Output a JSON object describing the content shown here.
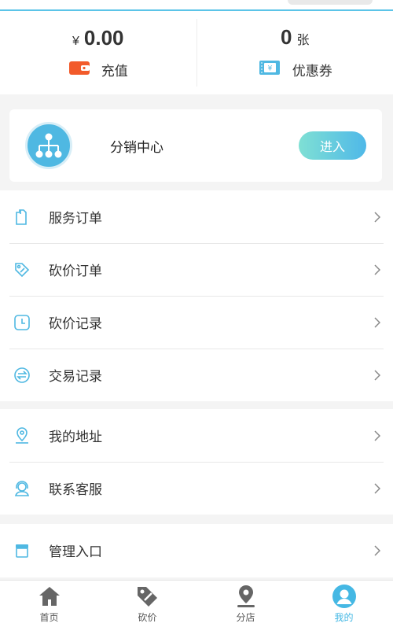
{
  "colors": {
    "accent": "#45b8e4",
    "wallet": "#f25a2a",
    "text": "#333333",
    "divider": "#e8e8e8"
  },
  "stats": {
    "balance": {
      "currency": "¥",
      "amount": "0.00",
      "icon": "wallet-icon",
      "label": "充值"
    },
    "coupons": {
      "count": "0",
      "unit": "张",
      "icon": "ticket-icon",
      "label": "优惠券"
    }
  },
  "distribution": {
    "icon": "network-icon",
    "title": "分销中心",
    "button": "进入"
  },
  "menu_group_1": [
    {
      "icon": "document-icon",
      "label": "服务订单"
    },
    {
      "icon": "tag-icon",
      "label": "砍价订单"
    },
    {
      "icon": "clock-icon",
      "label": "砍价记录"
    },
    {
      "icon": "exchange-icon",
      "label": "交易记录"
    }
  ],
  "menu_group_2": [
    {
      "icon": "location-icon",
      "label": "我的地址"
    },
    {
      "icon": "headset-icon",
      "label": "联系客服"
    }
  ],
  "menu_group_3": [
    {
      "icon": "store-icon",
      "label": "管理入口"
    }
  ],
  "tabbar": [
    {
      "icon": "home-icon",
      "label": "首页",
      "active": false
    },
    {
      "icon": "tag-icon",
      "label": "砍价",
      "active": false
    },
    {
      "icon": "location-pin-icon",
      "label": "分店",
      "active": false
    },
    {
      "icon": "user-icon",
      "label": "我的",
      "active": true
    }
  ]
}
